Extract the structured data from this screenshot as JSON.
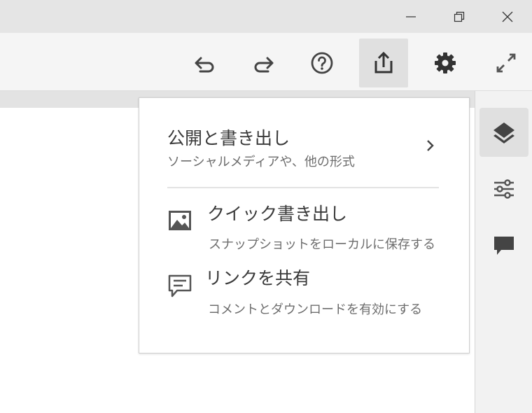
{
  "toolbar": {
    "buttons": [
      {
        "name": "undo",
        "icon": "undo-icon"
      },
      {
        "name": "redo",
        "icon": "redo-icon"
      },
      {
        "name": "help",
        "icon": "help-circle-icon"
      },
      {
        "name": "share",
        "icon": "share-export-icon",
        "active": true
      },
      {
        "name": "settings",
        "icon": "gear-icon"
      },
      {
        "name": "fullscreen",
        "icon": "expand-icon"
      }
    ]
  },
  "window_controls": [
    "minimize-icon",
    "restore-icon",
    "close-icon"
  ],
  "share_menu": {
    "header": {
      "title": "公開と書き出し",
      "subtitle": "ソーシャルメディアや、他の形式"
    },
    "items": [
      {
        "icon": "image-icon",
        "title": "クイック書き出し",
        "subtitle": "スナップショットをローカルに保存する"
      },
      {
        "icon": "comment-outline-icon",
        "title": "リンクを共有",
        "subtitle": "コメントとダウンロードを有効にする"
      }
    ]
  },
  "side_panel": {
    "buttons": [
      {
        "icon": "layers-icon",
        "active": true
      },
      {
        "icon": "sliders-icon"
      },
      {
        "icon": "comment-icon"
      }
    ]
  },
  "colors": {
    "titlebar": "#e5e5e5",
    "toolbar": "#f5f5f5",
    "active_button": "#e0e0e0",
    "icon": "#444444",
    "menu_text": "#3a3a3a",
    "menu_subtext": "#6d6d6d"
  }
}
